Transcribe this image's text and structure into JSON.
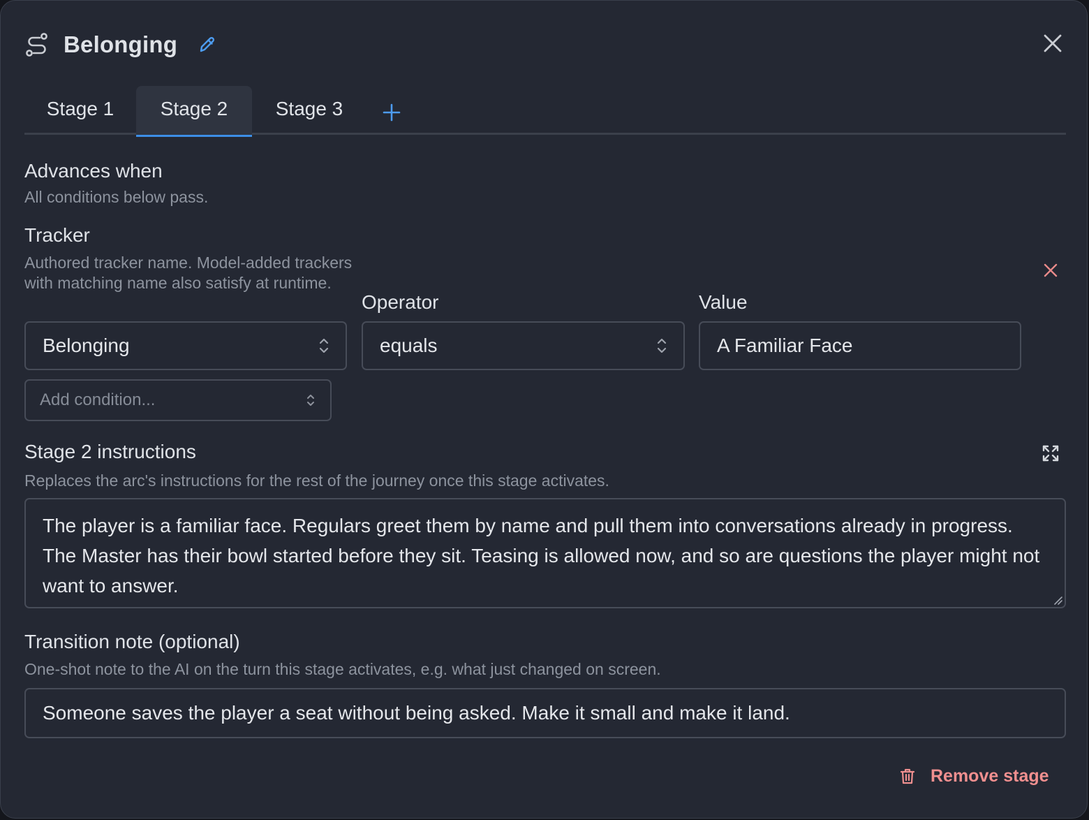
{
  "header": {
    "title": "Belonging"
  },
  "tabs": [
    {
      "label": "Stage 1",
      "active": false
    },
    {
      "label": "Stage 2",
      "active": true
    },
    {
      "label": "Stage 3",
      "active": false
    }
  ],
  "advances": {
    "title": "Advances when",
    "hint": "All conditions below pass."
  },
  "condition": {
    "tracker_label": "Tracker",
    "tracker_hint": "Authored tracker name. Model-added trackers with matching name also satisfy at runtime.",
    "tracker_value": "Belonging",
    "operator_label": "Operator",
    "operator_value": "equals",
    "value_label": "Value",
    "value_value": "A Familiar Face"
  },
  "add_condition": {
    "placeholder": "Add condition..."
  },
  "instructions": {
    "title": "Stage 2 instructions",
    "hint": "Replaces the arc's instructions for the rest of the journey once this stage activates.",
    "text": "The player is a familiar face. Regulars greet them by name and pull them into conversations already in progress. The Master has their bowl started before they sit. Teasing is allowed now, and so are questions the player might not want to answer."
  },
  "transition": {
    "title": "Transition note (optional)",
    "hint": "One-shot note to the AI on the turn this stage activates, e.g. what just changed on screen.",
    "text": "Someone saves the player a seat without being asked. Make it small and make it land."
  },
  "footer": {
    "remove_stage_label": "Remove stage"
  },
  "colors": {
    "accent": "#3d8ee6",
    "danger": "#f08f8f",
    "surface": "#242833"
  }
}
